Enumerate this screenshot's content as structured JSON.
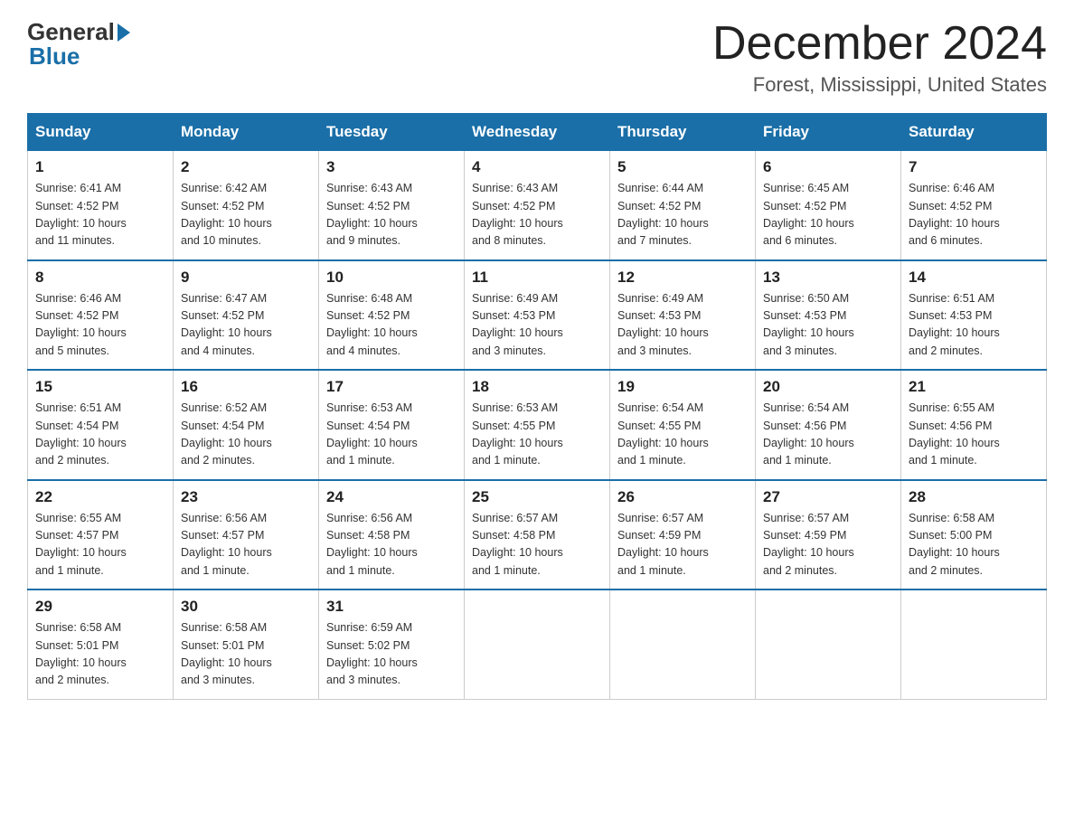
{
  "logo": {
    "general": "General",
    "blue": "Blue"
  },
  "title": "December 2024",
  "subtitle": "Forest, Mississippi, United States",
  "days_of_week": [
    "Sunday",
    "Monday",
    "Tuesday",
    "Wednesday",
    "Thursday",
    "Friday",
    "Saturday"
  ],
  "weeks": [
    [
      {
        "day": "1",
        "sunrise": "6:41 AM",
        "sunset": "4:52 PM",
        "daylight": "10 hours and 11 minutes."
      },
      {
        "day": "2",
        "sunrise": "6:42 AM",
        "sunset": "4:52 PM",
        "daylight": "10 hours and 10 minutes."
      },
      {
        "day": "3",
        "sunrise": "6:43 AM",
        "sunset": "4:52 PM",
        "daylight": "10 hours and 9 minutes."
      },
      {
        "day": "4",
        "sunrise": "6:43 AM",
        "sunset": "4:52 PM",
        "daylight": "10 hours and 8 minutes."
      },
      {
        "day": "5",
        "sunrise": "6:44 AM",
        "sunset": "4:52 PM",
        "daylight": "10 hours and 7 minutes."
      },
      {
        "day": "6",
        "sunrise": "6:45 AM",
        "sunset": "4:52 PM",
        "daylight": "10 hours and 6 minutes."
      },
      {
        "day": "7",
        "sunrise": "6:46 AM",
        "sunset": "4:52 PM",
        "daylight": "10 hours and 6 minutes."
      }
    ],
    [
      {
        "day": "8",
        "sunrise": "6:46 AM",
        "sunset": "4:52 PM",
        "daylight": "10 hours and 5 minutes."
      },
      {
        "day": "9",
        "sunrise": "6:47 AM",
        "sunset": "4:52 PM",
        "daylight": "10 hours and 4 minutes."
      },
      {
        "day": "10",
        "sunrise": "6:48 AM",
        "sunset": "4:52 PM",
        "daylight": "10 hours and 4 minutes."
      },
      {
        "day": "11",
        "sunrise": "6:49 AM",
        "sunset": "4:53 PM",
        "daylight": "10 hours and 3 minutes."
      },
      {
        "day": "12",
        "sunrise": "6:49 AM",
        "sunset": "4:53 PM",
        "daylight": "10 hours and 3 minutes."
      },
      {
        "day": "13",
        "sunrise": "6:50 AM",
        "sunset": "4:53 PM",
        "daylight": "10 hours and 3 minutes."
      },
      {
        "day": "14",
        "sunrise": "6:51 AM",
        "sunset": "4:53 PM",
        "daylight": "10 hours and 2 minutes."
      }
    ],
    [
      {
        "day": "15",
        "sunrise": "6:51 AM",
        "sunset": "4:54 PM",
        "daylight": "10 hours and 2 minutes."
      },
      {
        "day": "16",
        "sunrise": "6:52 AM",
        "sunset": "4:54 PM",
        "daylight": "10 hours and 2 minutes."
      },
      {
        "day": "17",
        "sunrise": "6:53 AM",
        "sunset": "4:54 PM",
        "daylight": "10 hours and 1 minute."
      },
      {
        "day": "18",
        "sunrise": "6:53 AM",
        "sunset": "4:55 PM",
        "daylight": "10 hours and 1 minute."
      },
      {
        "day": "19",
        "sunrise": "6:54 AM",
        "sunset": "4:55 PM",
        "daylight": "10 hours and 1 minute."
      },
      {
        "day": "20",
        "sunrise": "6:54 AM",
        "sunset": "4:56 PM",
        "daylight": "10 hours and 1 minute."
      },
      {
        "day": "21",
        "sunrise": "6:55 AM",
        "sunset": "4:56 PM",
        "daylight": "10 hours and 1 minute."
      }
    ],
    [
      {
        "day": "22",
        "sunrise": "6:55 AM",
        "sunset": "4:57 PM",
        "daylight": "10 hours and 1 minute."
      },
      {
        "day": "23",
        "sunrise": "6:56 AM",
        "sunset": "4:57 PM",
        "daylight": "10 hours and 1 minute."
      },
      {
        "day": "24",
        "sunrise": "6:56 AM",
        "sunset": "4:58 PM",
        "daylight": "10 hours and 1 minute."
      },
      {
        "day": "25",
        "sunrise": "6:57 AM",
        "sunset": "4:58 PM",
        "daylight": "10 hours and 1 minute."
      },
      {
        "day": "26",
        "sunrise": "6:57 AM",
        "sunset": "4:59 PM",
        "daylight": "10 hours and 1 minute."
      },
      {
        "day": "27",
        "sunrise": "6:57 AM",
        "sunset": "4:59 PM",
        "daylight": "10 hours and 2 minutes."
      },
      {
        "day": "28",
        "sunrise": "6:58 AM",
        "sunset": "5:00 PM",
        "daylight": "10 hours and 2 minutes."
      }
    ],
    [
      {
        "day": "29",
        "sunrise": "6:58 AM",
        "sunset": "5:01 PM",
        "daylight": "10 hours and 2 minutes."
      },
      {
        "day": "30",
        "sunrise": "6:58 AM",
        "sunset": "5:01 PM",
        "daylight": "10 hours and 3 minutes."
      },
      {
        "day": "31",
        "sunrise": "6:59 AM",
        "sunset": "5:02 PM",
        "daylight": "10 hours and 3 minutes."
      },
      null,
      null,
      null,
      null
    ]
  ],
  "labels": {
    "sunrise": "Sunrise:",
    "sunset": "Sunset:",
    "daylight": "Daylight:"
  }
}
